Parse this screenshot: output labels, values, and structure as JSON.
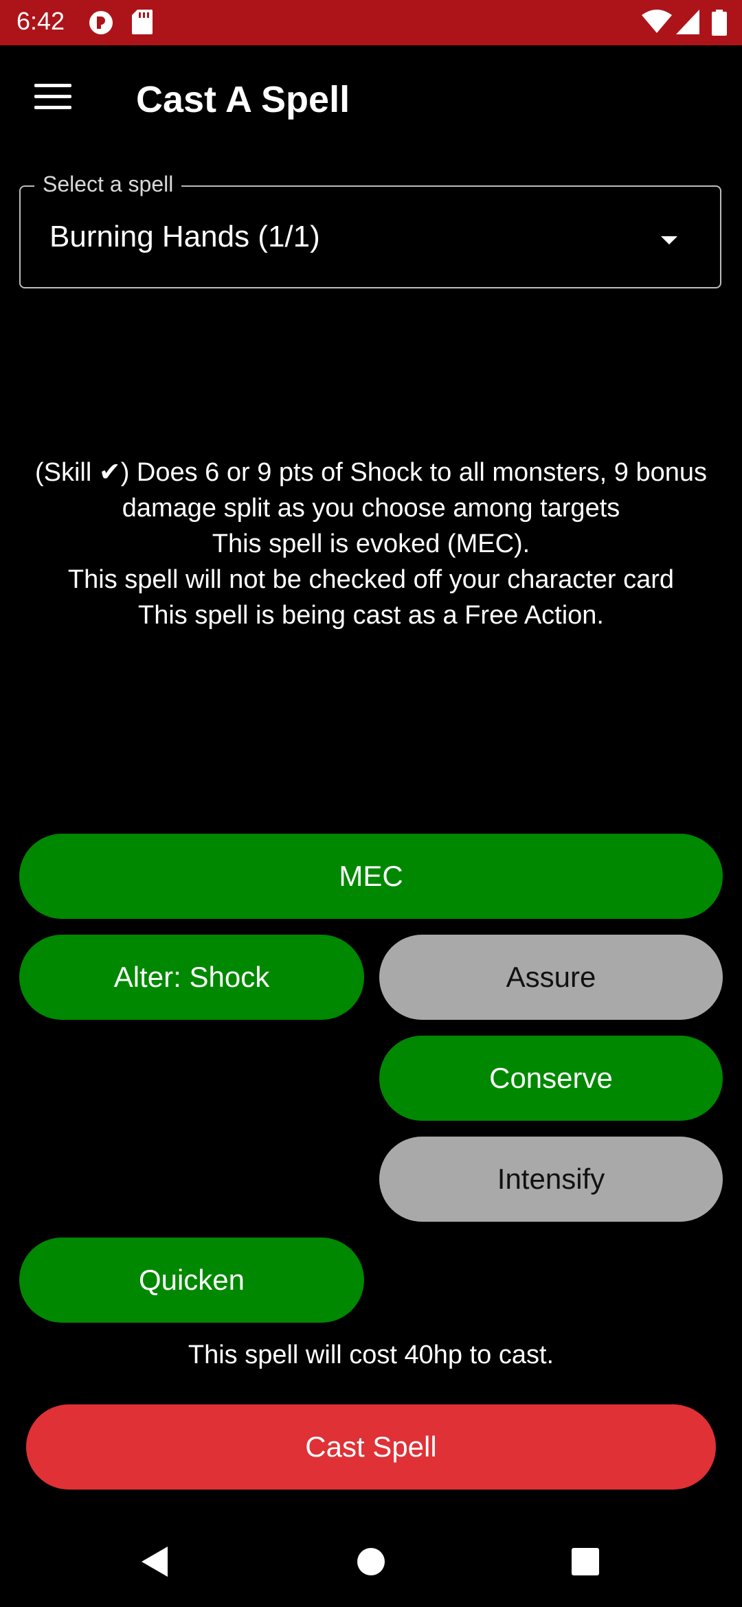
{
  "status_bar": {
    "time": "6:42",
    "icons": [
      "app-notification-icon",
      "sd-card-icon",
      "wifi-icon",
      "signal-icon",
      "battery-icon"
    ],
    "background_color": "#ad1419"
  },
  "app_bar": {
    "title": "Cast A Spell",
    "menu_icon": "hamburger-menu-icon"
  },
  "spell_select": {
    "label": "Select a spell",
    "value": "Burning Hands (1/1)",
    "caret_icon": "dropdown-arrow-icon"
  },
  "description": {
    "lines": [
      "(Skill ✔) Does 6 or 9 pts of Shock to all monsters, 9 bonus\ndamage split as you choose among targets",
      "This spell is evoked (MEC).",
      "This spell will not be checked off your character card",
      "This spell is being cast as a Free Action."
    ]
  },
  "options": {
    "mec": {
      "label": "MEC",
      "state": "active"
    },
    "alter": {
      "label": "Alter: Shock",
      "state": "active"
    },
    "assure": {
      "label": "Assure",
      "state": "inactive"
    },
    "conserve": {
      "label": "Conserve",
      "state": "active"
    },
    "intensify": {
      "label": "Intensify",
      "state": "inactive"
    },
    "quicken": {
      "label": "Quicken",
      "state": "active"
    }
  },
  "cost_text": "This spell will cost 40hp to cast.",
  "cast_button": {
    "label": "Cast Spell"
  },
  "colors": {
    "active": "#008800",
    "inactive": "#a9a9a9",
    "cast": "#df3136"
  },
  "nav_bar": {
    "icons": [
      "back-icon",
      "home-icon",
      "recents-icon"
    ]
  }
}
